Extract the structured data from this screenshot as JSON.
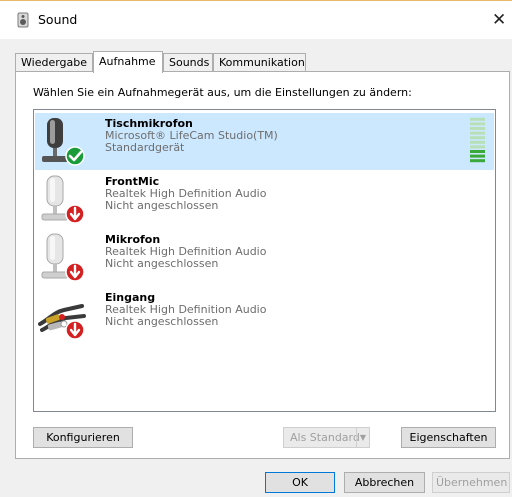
{
  "window": {
    "title": "Sound",
    "close_glyph": "✕"
  },
  "tabs": [
    {
      "label": "Wiedergabe",
      "active": false
    },
    {
      "label": "Aufnahme",
      "active": true
    },
    {
      "label": "Sounds",
      "active": false
    },
    {
      "label": "Kommunikation",
      "active": false
    }
  ],
  "instruction": "Wählen Sie ein Aufnahmegerät aus, um die Einstellungen zu ändern:",
  "devices": [
    {
      "name": "Tischmikrofon",
      "driver": "Microsoft® LifeCam Studio(TM)",
      "status": "Standardgerät",
      "icon": "microphone-default-icon",
      "selected": true,
      "level": 0.3
    },
    {
      "name": "FrontMic",
      "driver": "Realtek High Definition Audio",
      "status": "Nicht angeschlossen",
      "icon": "microphone-unplugged-icon",
      "selected": false
    },
    {
      "name": "Mikrofon",
      "driver": "Realtek High Definition Audio",
      "status": "Nicht angeschlossen",
      "icon": "microphone-unplugged-icon",
      "selected": false
    },
    {
      "name": "Eingang",
      "driver": "Realtek High Definition Audio",
      "status": "Nicht angeschlossen",
      "icon": "line-in-unplugged-icon",
      "selected": false
    }
  ],
  "buttons": {
    "configure": "Konfigurieren",
    "set_default": "Als Standard",
    "properties": "Eigenschaften",
    "ok": "OK",
    "cancel": "Abbrechen",
    "apply": "Übernehmen"
  },
  "colors": {
    "selection": "#cce8ff",
    "default_badge": "#1a9c3a",
    "unplugged_badge": "#d42020",
    "level_active": "#3aa83a",
    "level_inactive": "#b8e0b8"
  }
}
